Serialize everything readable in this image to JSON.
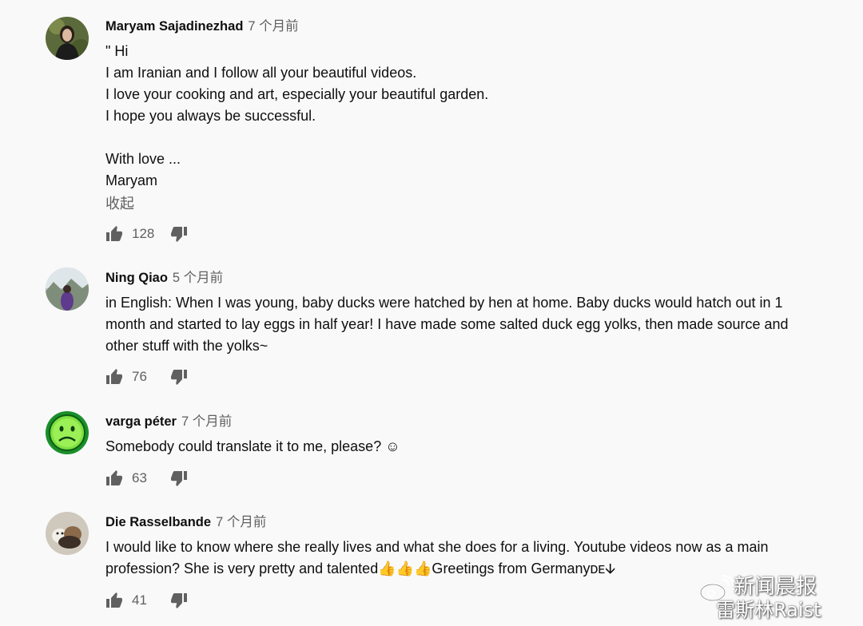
{
  "comments": [
    {
      "author": "Maryam Sajadinezhad",
      "time": "7 个月前",
      "lines": [
        "\" Hi",
        "I am Iranian and I follow all your beautiful videos.",
        "I love your cooking and art, especially your beautiful garden.",
        "I hope you always be successful.",
        "",
        "With love ...",
        "Maryam"
      ],
      "collapse_label": "收起",
      "likes": "128"
    },
    {
      "author": "Ning Qiao",
      "time": "5 个月前",
      "lines": [
        "in English: When I was young, baby ducks were hatched by hen at home. Baby ducks would hatch out in 1",
        "month and started to lay eggs in half year! I have made some salted duck egg yolks, then made source and",
        "other stuff with the yolks~"
      ],
      "likes": "76"
    },
    {
      "author": "varga péter",
      "time": "7 个月前",
      "lines": [
        "Somebody could translate it to me, please? ☺"
      ],
      "likes": "63"
    },
    {
      "author": "Die Rasselbande",
      "time": "7 个月前",
      "lines": [
        "I would like to know where she really lives and what she does for a living. Youtube videos now as a main",
        "profession? She is very pretty and talented👍👍👍Greetings from Germanyᴅᴇ🡫"
      ],
      "likes": "41"
    }
  ],
  "icons": {
    "like": "thumbs-up-icon",
    "dislike": "thumbs-down-icon"
  },
  "watermark": {
    "line1": "新闻晨报",
    "line2": "雷斯林Raist"
  },
  "colors": {
    "background": "#f9f9f9",
    "text": "#0f0f0f",
    "secondary": "#606060"
  }
}
